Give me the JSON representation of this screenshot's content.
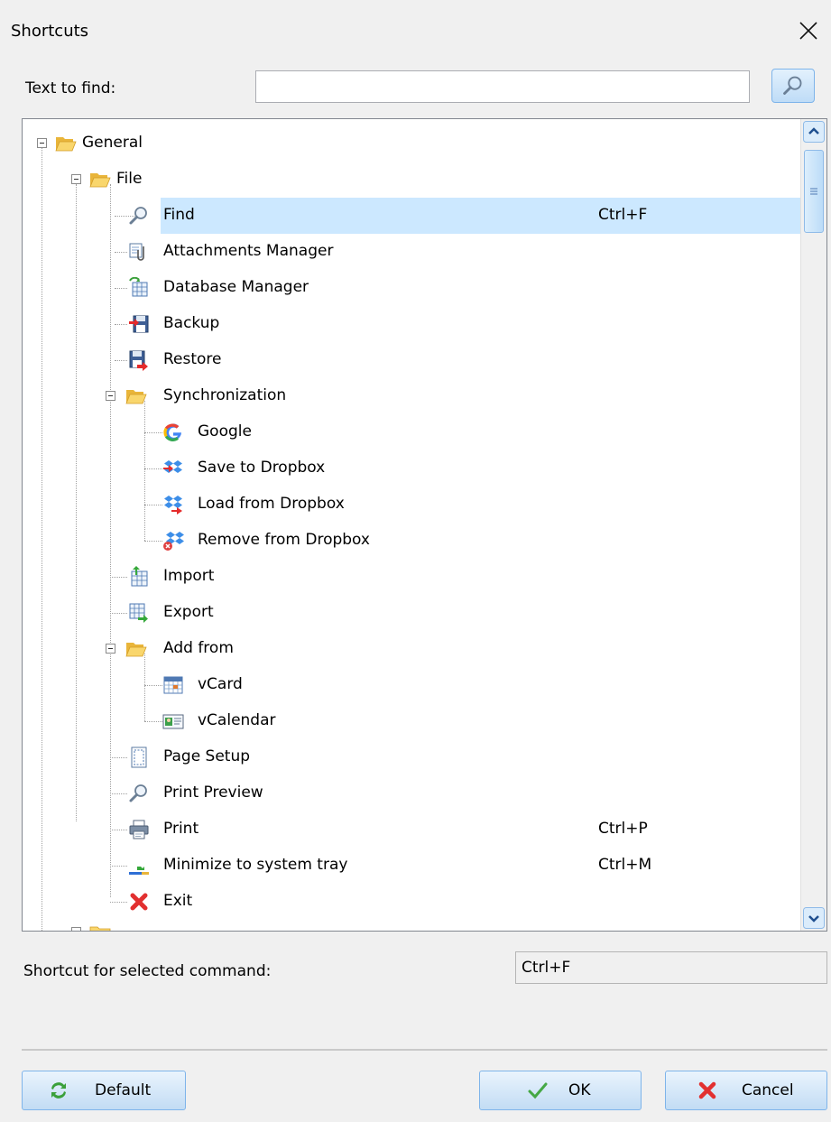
{
  "dialog": {
    "title": "Shortcuts"
  },
  "search": {
    "label": "Text to find:",
    "value": "",
    "placeholder": ""
  },
  "tree": {
    "rows": [
      {
        "label": "General",
        "shortcut": ""
      },
      {
        "label": "File",
        "shortcut": ""
      },
      {
        "label": "Find",
        "shortcut": "Ctrl+F"
      },
      {
        "label": "Attachments Manager",
        "shortcut": ""
      },
      {
        "label": "Database Manager",
        "shortcut": ""
      },
      {
        "label": "Backup",
        "shortcut": ""
      },
      {
        "label": "Restore",
        "shortcut": ""
      },
      {
        "label": "Synchronization",
        "shortcut": ""
      },
      {
        "label": "Google",
        "shortcut": ""
      },
      {
        "label": "Save to Dropbox",
        "shortcut": ""
      },
      {
        "label": "Load from Dropbox",
        "shortcut": ""
      },
      {
        "label": "Remove from Dropbox",
        "shortcut": ""
      },
      {
        "label": "Import",
        "shortcut": ""
      },
      {
        "label": "Export",
        "shortcut": ""
      },
      {
        "label": "Add from",
        "shortcut": ""
      },
      {
        "label": "vCard",
        "shortcut": ""
      },
      {
        "label": "vCalendar",
        "shortcut": ""
      },
      {
        "label": "Page Setup",
        "shortcut": ""
      },
      {
        "label": "Print Preview",
        "shortcut": ""
      },
      {
        "label": "Print",
        "shortcut": "Ctrl+P"
      },
      {
        "label": "Minimize to system tray",
        "shortcut": "Ctrl+M"
      },
      {
        "label": "Exit",
        "shortcut": ""
      }
    ]
  },
  "shortcut": {
    "label": "Shortcut for selected command:",
    "value": "Ctrl+F"
  },
  "buttons": {
    "default": "Default",
    "ok": "OK",
    "cancel": "Cancel"
  },
  "colors": {
    "selection": "#cce8ff",
    "button_border": "#7eb4ea",
    "folder": "#f5c745"
  }
}
